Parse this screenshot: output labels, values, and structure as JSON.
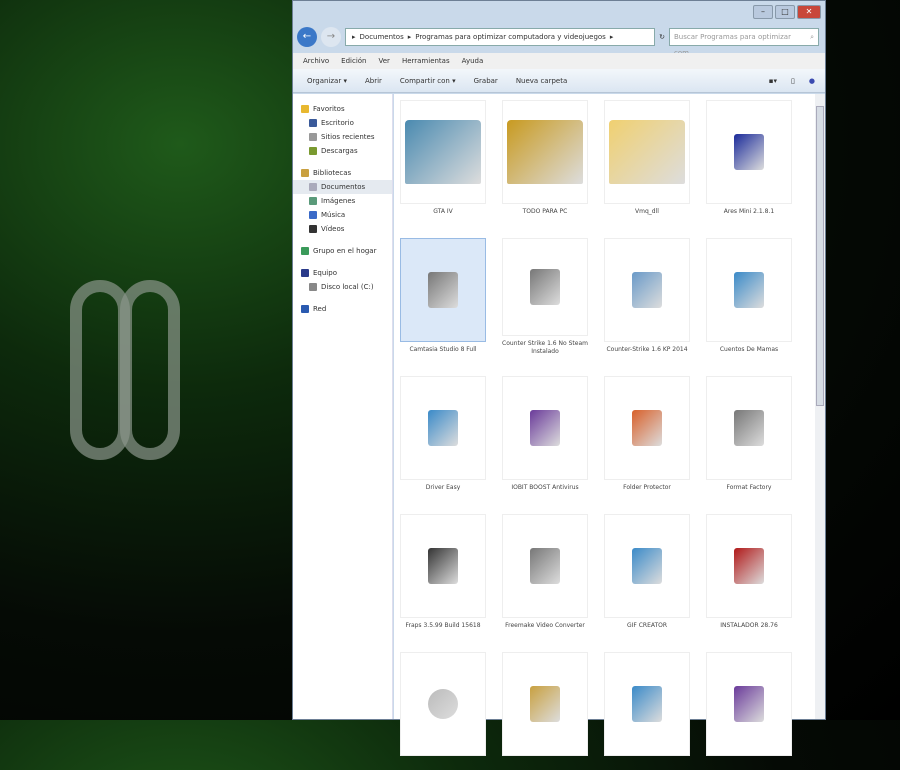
{
  "window": {
    "controls": [
      "–",
      "□",
      "✕"
    ]
  },
  "address": {
    "path": [
      "Documentos",
      "Programas para optimizar computadora y videojuegos"
    ],
    "search_placeholder": "Buscar Programas para optimizar com..."
  },
  "menu": [
    "Archivo",
    "Edición",
    "Ver",
    "Herramientas",
    "Ayuda"
  ],
  "toolbar": {
    "organize": "Organizar ▾",
    "open": "Abrir",
    "share": "Compartir con ▾",
    "burn": "Grabar",
    "new_folder": "Nueva carpeta"
  },
  "sidebar": [
    {
      "label": "Favoritos",
      "group": true,
      "icon": "star-icon",
      "color": "#e8b830"
    },
    {
      "label": "Escritorio",
      "icon": "desktop-icon",
      "color": "#3a5a9a"
    },
    {
      "label": "Sitios recientes",
      "icon": "recent-icon",
      "color": "#999"
    },
    {
      "label": "Descargas",
      "icon": "downloads-icon",
      "color": "#7a9a30"
    },
    {
      "label": "Bibliotecas",
      "group": true,
      "icon": "library-icon",
      "color": "#c9a040"
    },
    {
      "label": "Documentos",
      "icon": "documents-icon",
      "color": "#aab",
      "selected": true
    },
    {
      "label": "Imágenes",
      "icon": "pictures-icon",
      "color": "#5a9a7a"
    },
    {
      "label": "Música",
      "icon": "music-icon",
      "color": "#3a6ac8"
    },
    {
      "label": "Vídeos",
      "icon": "videos-icon",
      "color": "#333"
    },
    {
      "label": "Grupo en el hogar",
      "group": true,
      "icon": "homegroup-icon",
      "color": "#3a9a5a"
    },
    {
      "label": "Equipo",
      "group": true,
      "icon": "computer-icon",
      "color": "#2a3a8a"
    },
    {
      "label": "Disco local (C:)",
      "icon": "drive-icon",
      "color": "#888"
    },
    {
      "label": "Red",
      "group": true,
      "icon": "network-icon",
      "color": "#2a5ab0"
    }
  ],
  "files": [
    {
      "name": "GTA IV",
      "type": "folder",
      "color": "#4a8ab0"
    },
    {
      "name": "TODO PARA PC",
      "type": "folder",
      "color": "#c89a20"
    },
    {
      "name": "Vmq_dll",
      "type": "folder",
      "color": "#f0d070"
    },
    {
      "name": "Ares Mini 2.1.8.1",
      "type": "app",
      "color": "#1a2a9a"
    },
    {
      "name": "Camtasia Studio 8 Full",
      "type": "installer",
      "color": "#777",
      "selected": true
    },
    {
      "name": "Counter Strike 1.6 No Steam Instalado",
      "type": "installer",
      "color": "#777"
    },
    {
      "name": "Counter-Strike 1.6 KP 2014",
      "type": "setup",
      "color": "#6a9ac8"
    },
    {
      "name": "Cuentos De Mamas",
      "type": "setup",
      "color": "#3a8ac8"
    },
    {
      "name": "Driver Easy",
      "type": "setup",
      "color": "#3a8ac8"
    },
    {
      "name": "IOBIT BOOST Antivirus",
      "type": "archive",
      "color": "#6a3a9a"
    },
    {
      "name": "Folder Protector",
      "type": "app",
      "color": "#d8602a"
    },
    {
      "name": "Format Factory",
      "type": "installer",
      "color": "#777"
    },
    {
      "name": "Fraps 3.5.99 Build 15618",
      "type": "setup",
      "color": "#333"
    },
    {
      "name": "Freemake Video Converter",
      "type": "installer",
      "color": "#777"
    },
    {
      "name": "GIF CREATOR",
      "type": "setup",
      "color": "#3a8ac8"
    },
    {
      "name": "INSTALADOR 28.76",
      "type": "app",
      "color": "#b01818"
    },
    {
      "name": "",
      "type": "disc",
      "color": "#bbb"
    },
    {
      "name": "",
      "type": "app",
      "color": "#c8a040"
    },
    {
      "name": "",
      "type": "setup",
      "color": "#3a8ac8"
    },
    {
      "name": "",
      "type": "archive",
      "color": "#6a3a9a"
    }
  ]
}
